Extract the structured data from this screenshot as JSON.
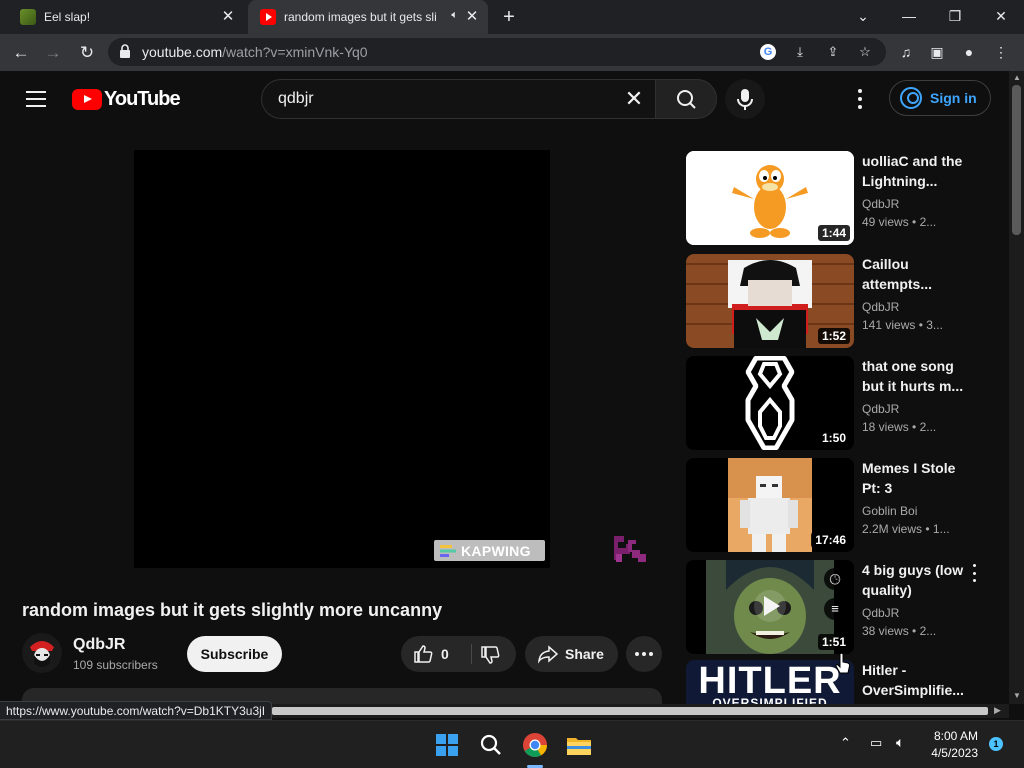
{
  "browser": {
    "tabs": [
      {
        "title": "Eel slap!",
        "favicon": "eel-favicon"
      },
      {
        "title": "random images but it gets slightly more uncanny",
        "favicon": "youtube-favicon",
        "audio": true,
        "active": true
      }
    ],
    "address": {
      "host": "youtube.com",
      "path": "/watch?v=xminVnk-Yq0"
    },
    "status_url": "https://www.youtube.com/watch?v=Db1KTY3u3jI"
  },
  "youtube": {
    "logo_text": "YouTube",
    "search_query": "qdbjr",
    "signin_label": "Sign in",
    "accent": "#3ea6ff"
  },
  "video": {
    "title": "random images but it gets slightly more uncanny",
    "watermark": "KAPWING",
    "channel": "QdbJR",
    "subscribers": "109 subscribers",
    "subscribe_label": "Subscribe",
    "likes": "0",
    "share_label": "Share"
  },
  "recommendations": [
    {
      "title": "uolliaC and the Lightning...",
      "channel": "QdbJR",
      "views": "49 views",
      "age": "2...",
      "duration": "1:44",
      "thumb": "garfield"
    },
    {
      "title": "Caillou attempts...",
      "channel": "QdbJR",
      "views": "141 views",
      "age": "3...",
      "duration": "1:52",
      "thumb": "roblox-avatar"
    },
    {
      "title": "that one song but it hurts m...",
      "channel": "QdbJR",
      "views": "18 views",
      "age": "2...",
      "duration": "1:50",
      "thumb": "number-eight"
    },
    {
      "title": "Memes I Stole Pt: 3",
      "channel": "Goblin Boi",
      "views": "2.2M views",
      "age": "1...",
      "duration": "17:46",
      "thumb": "roblox-figure"
    },
    {
      "title": "4 big guys (low quality)",
      "channel": "QdbJR",
      "views": "38 views",
      "age": "2...",
      "duration": "1:51",
      "thumb": "green-face"
    },
    {
      "title": "Hitler - OverSimplifie...",
      "thumb_text": "HITLER",
      "thumb_subtext": "OVERSIMPLIFIED",
      "thumb": "hitler-title-card"
    }
  ],
  "taskbar": {
    "time": "8:00 AM",
    "date": "4/5/2023",
    "notifications": "1"
  }
}
